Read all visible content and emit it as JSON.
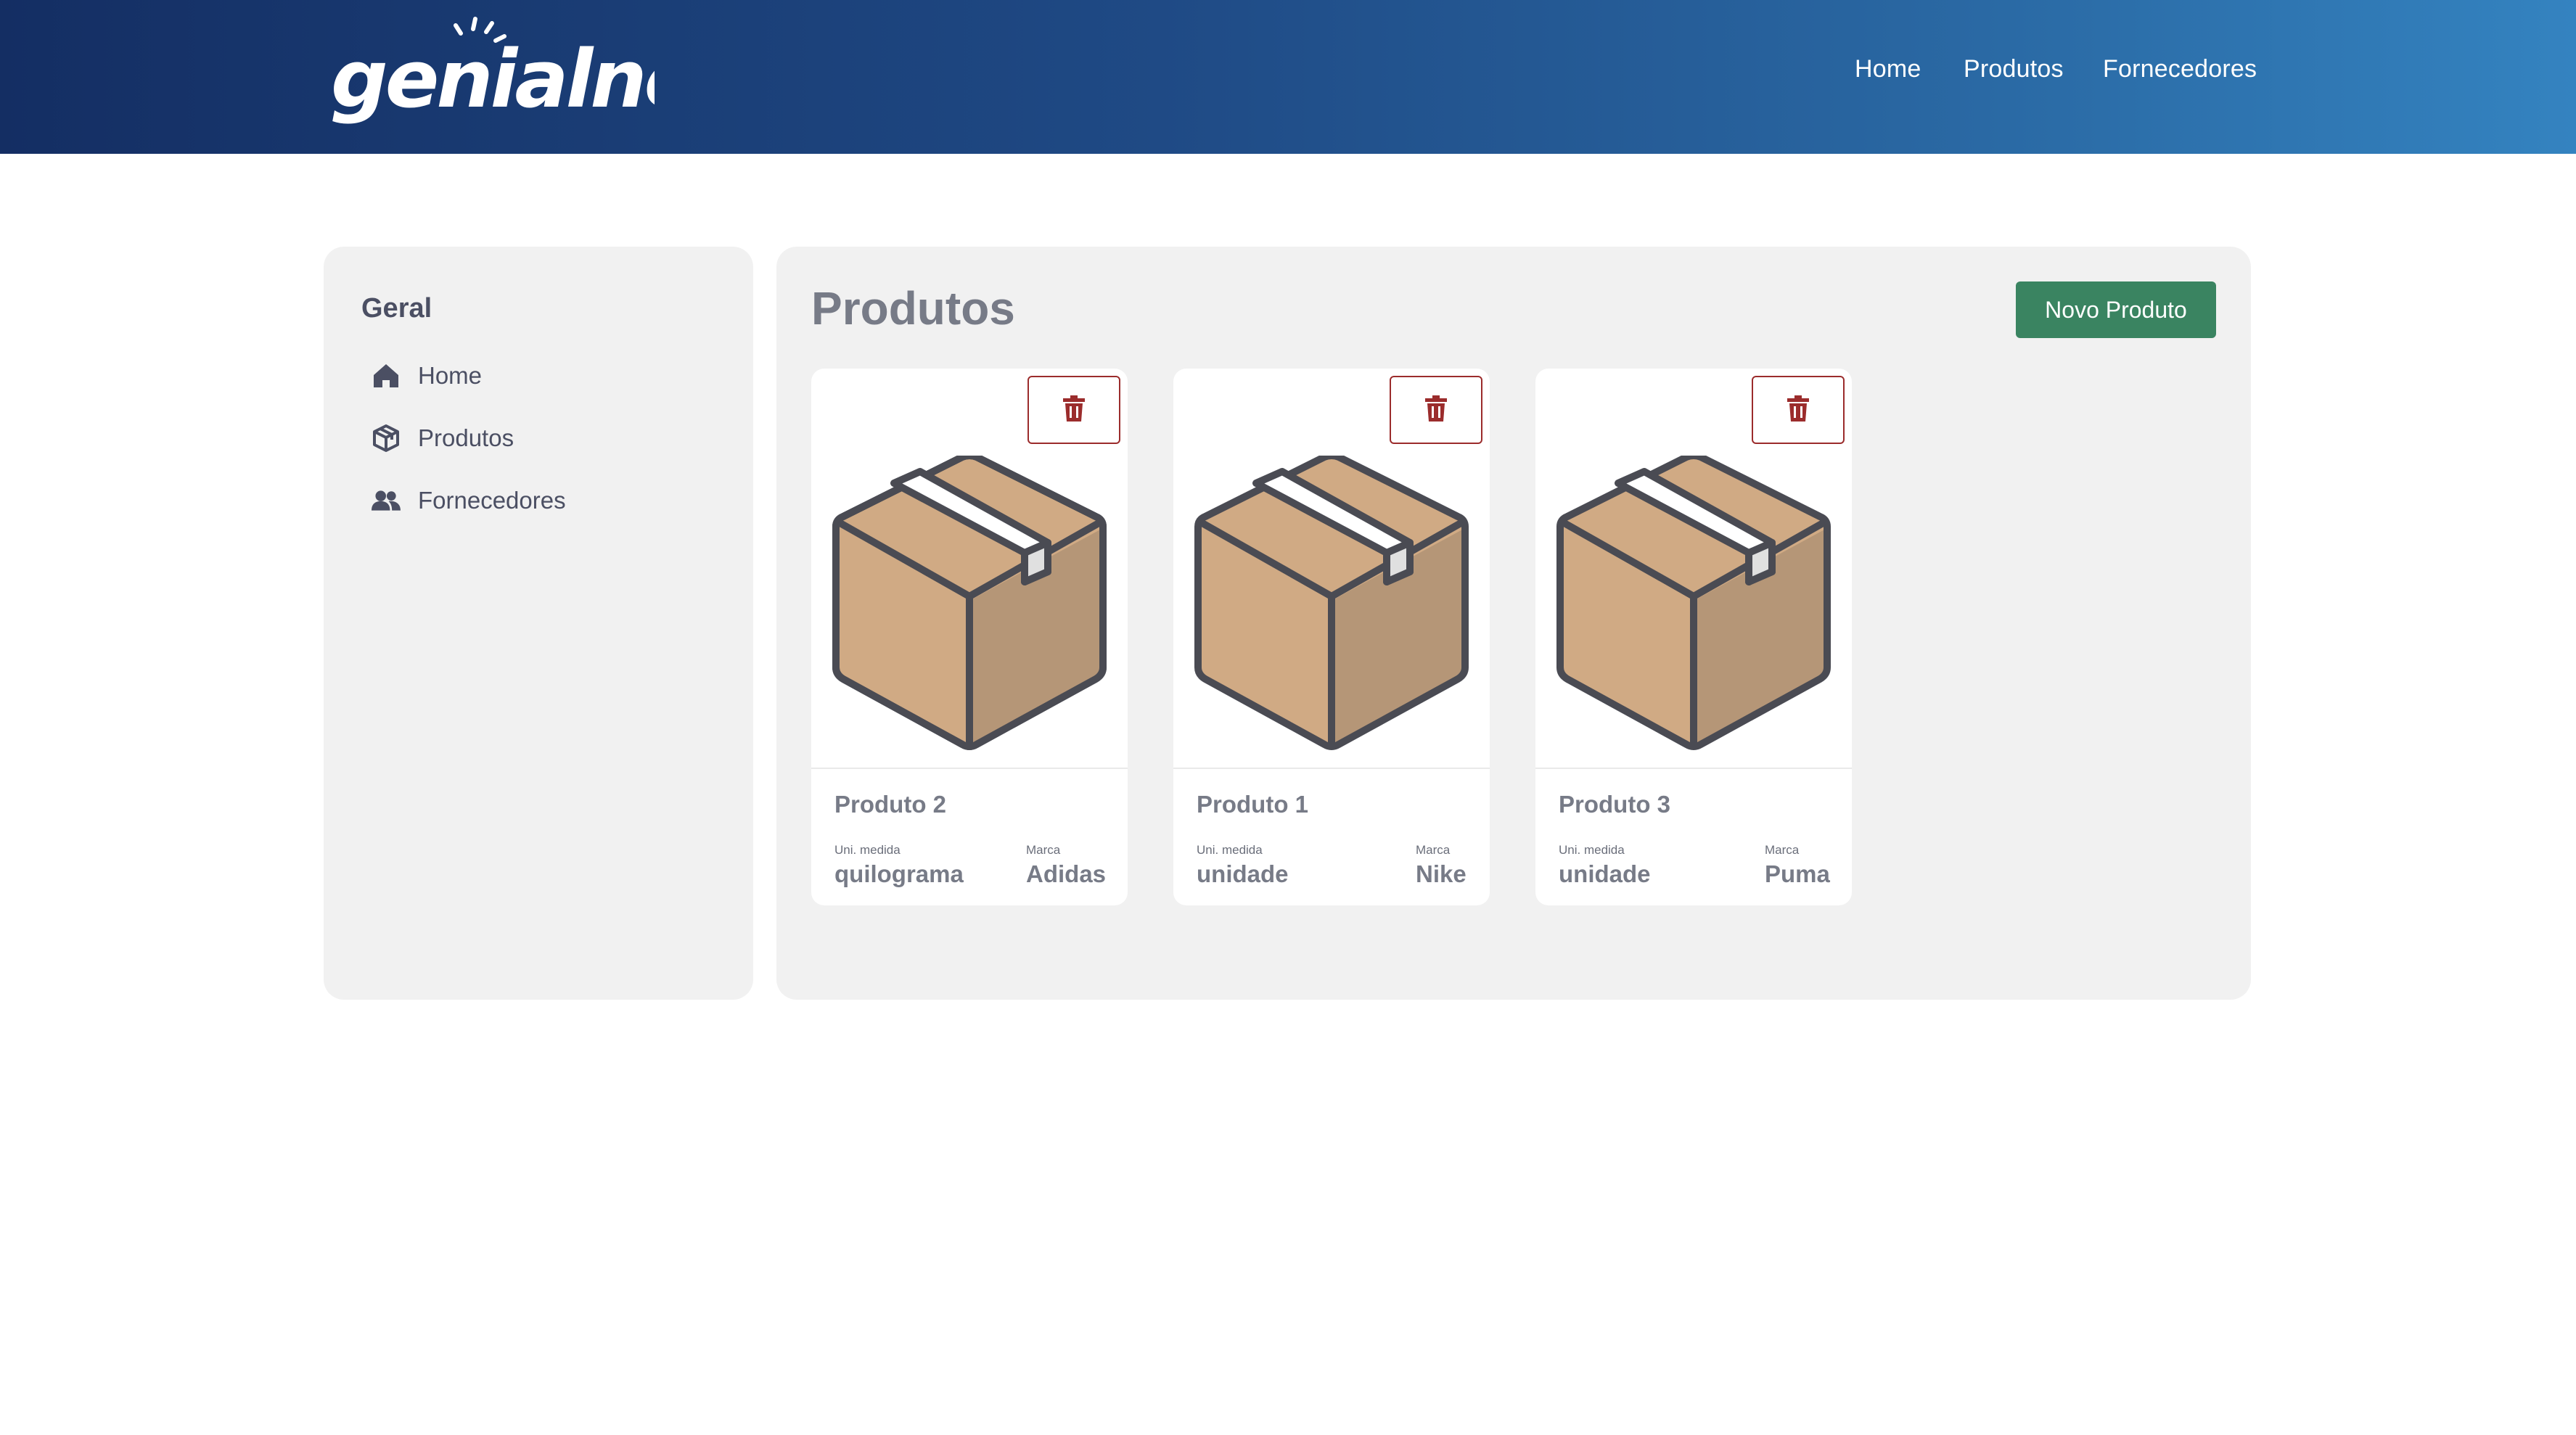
{
  "brand": {
    "logo_text": "genialnet"
  },
  "topnav": {
    "items": [
      {
        "label": "Home"
      },
      {
        "label": "Produtos"
      },
      {
        "label": "Fornecedores"
      }
    ]
  },
  "sidebar": {
    "title": "Geral",
    "items": [
      {
        "label": "Home",
        "icon": "home-icon"
      },
      {
        "label": "Produtos",
        "icon": "box-icon"
      },
      {
        "label": "Fornecedores",
        "icon": "users-icon"
      }
    ]
  },
  "main": {
    "title": "Produtos",
    "new_button_label": "Novo Produto",
    "unit_label": "Uni. medida",
    "brand_label": "Marca",
    "products": [
      {
        "name": "Produto 2",
        "unit": "quilograma",
        "brand": "Adidas"
      },
      {
        "name": "Produto 1",
        "unit": "unidade",
        "brand": "Nike"
      },
      {
        "name": "Produto 3",
        "unit": "unidade",
        "brand": "Puma"
      }
    ]
  },
  "colors": {
    "header_start": "#142e63",
    "header_end": "#3483c0",
    "primary_button": "#3a8461",
    "delete_accent": "#9b2c2c",
    "panel_bg": "#f1f1f1"
  }
}
